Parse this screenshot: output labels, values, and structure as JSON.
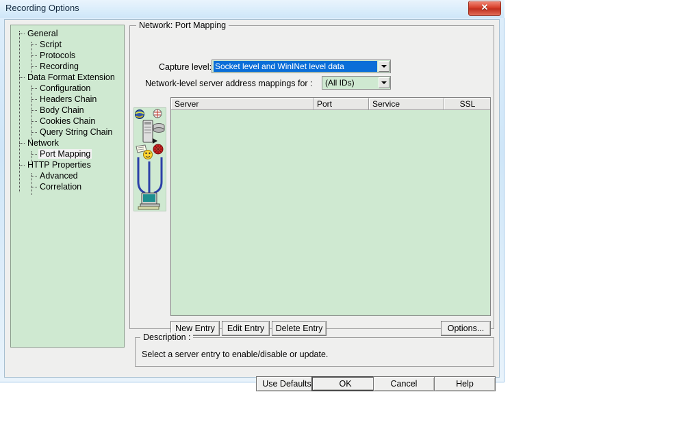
{
  "window": {
    "title": "Recording Options",
    "close_label": "✕"
  },
  "sidebar": {
    "items": [
      {
        "label": "General",
        "level": 0,
        "selected": false
      },
      {
        "label": "Script",
        "level": 1,
        "selected": false
      },
      {
        "label": "Protocols",
        "level": 1,
        "selected": false
      },
      {
        "label": "Recording",
        "level": 1,
        "selected": false
      },
      {
        "label": "Data Format Extension",
        "level": 0,
        "selected": false
      },
      {
        "label": "Configuration",
        "level": 1,
        "selected": false
      },
      {
        "label": "Headers Chain",
        "level": 1,
        "selected": false
      },
      {
        "label": "Body Chain",
        "level": 1,
        "selected": false
      },
      {
        "label": "Cookies Chain",
        "level": 1,
        "selected": false
      },
      {
        "label": "Query String Chain",
        "level": 1,
        "selected": false
      },
      {
        "label": "Network",
        "level": 0,
        "selected": false
      },
      {
        "label": "Port Mapping",
        "level": 1,
        "selected": true
      },
      {
        "label": "HTTP Properties",
        "level": 0,
        "selected": false
      },
      {
        "label": "Advanced",
        "level": 1,
        "selected": false
      },
      {
        "label": "Correlation",
        "level": 1,
        "selected": false
      }
    ]
  },
  "main": {
    "group_title": "Network: Port Mapping",
    "capture_level_label": "Capture level:",
    "capture_level_value": "Socket level and WinINet level data",
    "mappings_label": "Network-level server address mappings for :",
    "mappings_value": "(All IDs)",
    "illustration_name": "network-topology-illustration",
    "list": {
      "columns": [
        "Server",
        "Port",
        "Service",
        "SSL"
      ],
      "rows": []
    },
    "buttons": {
      "new_entry": "New Entry",
      "edit_entry": "Edit Entry",
      "delete_entry": "Delete Entry",
      "options": "Options..."
    },
    "description": {
      "title": "Description :",
      "text": "Select a server entry to enable/disable or update."
    }
  },
  "footer": {
    "use_defaults": "Use Defaults",
    "ok": "OK",
    "cancel": "Cancel",
    "help": "Help"
  },
  "colors": {
    "dialog_bg": "#efefee",
    "panel_green": "#cfe9d1",
    "highlight_blue": "#0a6ed8",
    "title_bar": "#dceefb",
    "close_red": "#d8412c"
  }
}
